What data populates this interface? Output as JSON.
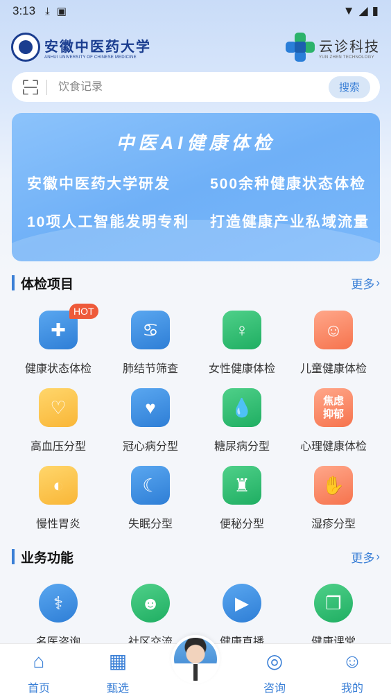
{
  "status_bar": {
    "time": "3:13"
  },
  "header": {
    "university_cn": "安徽中医药大学",
    "university_en": "ANHUI UNIVERSITY OF CHINESE MEDICINE",
    "brand_cn": "云诊科技",
    "brand_en": "YUN ZHEN TECHNOLOGY"
  },
  "search": {
    "placeholder": "饮食记录",
    "button": "搜索"
  },
  "banner": {
    "title": "中医AI健康体检",
    "line1_left": "安徽中医药大学研发",
    "line1_right": "500余种健康状态体检",
    "line2_left": "10项人工智能发明专利",
    "line2_right": "打造健康产业私域流量"
  },
  "exam_section": {
    "title": "体检项目",
    "more": "更多",
    "items": [
      {
        "label": "健康状态体检",
        "icon": "health-check-icon",
        "badge": "HOT"
      },
      {
        "label": "肺结节筛查",
        "icon": "lungs-icon"
      },
      {
        "label": "女性健康体检",
        "icon": "woman-icon"
      },
      {
        "label": "儿童健康体检",
        "icon": "child-icon"
      },
      {
        "label": "高血压分型",
        "icon": "stethoscope-icon"
      },
      {
        "label": "冠心病分型",
        "icon": "heart-icon"
      },
      {
        "label": "糖尿病分型",
        "icon": "drop-icon"
      },
      {
        "label": "心理健康体检",
        "icon": "mind-icon",
        "icon_text": "焦虑\n抑郁"
      },
      {
        "label": "慢性胃炎",
        "icon": "stomach-icon"
      },
      {
        "label": "失眠分型",
        "icon": "sleep-icon"
      },
      {
        "label": "便秘分型",
        "icon": "toilet-icon"
      },
      {
        "label": "湿疹分型",
        "icon": "hand-icon"
      }
    ]
  },
  "business_section": {
    "title": "业务功能",
    "more": "更多",
    "items": [
      {
        "label": "名医咨询",
        "icon": "doctor-icon"
      },
      {
        "label": "社区交流",
        "icon": "community-icon"
      },
      {
        "label": "健康直播",
        "icon": "video-icon"
      },
      {
        "label": "健康课堂",
        "icon": "book-icon"
      }
    ]
  },
  "tabbar": {
    "tabs": [
      {
        "label": "首页",
        "icon": "home-icon"
      },
      {
        "label": "甄选",
        "icon": "shop-icon"
      },
      {
        "label": "咨询",
        "icon": "chat-icon"
      },
      {
        "label": "我的",
        "icon": "user-icon"
      }
    ]
  },
  "colors": {
    "accent": "#3a7fd6",
    "hot": "#ee5a3a"
  }
}
